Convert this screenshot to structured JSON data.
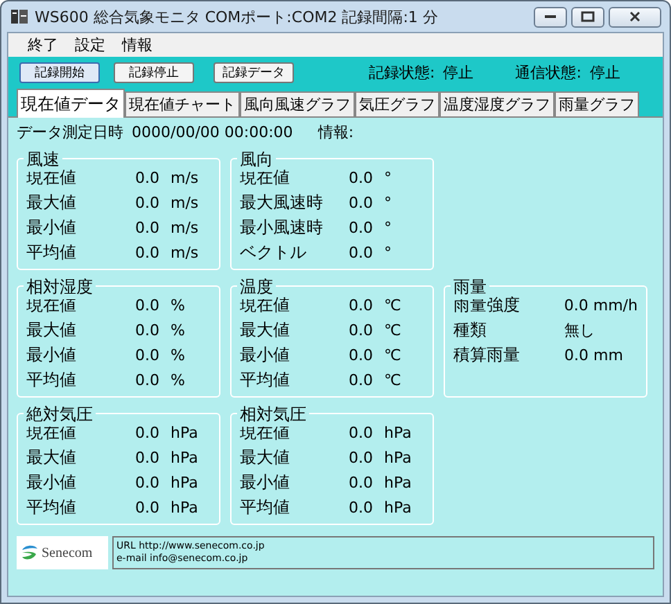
{
  "window": {
    "title": "WS600 総合気象モニタ COMポート:COM2 記録間隔:1 分"
  },
  "menu": [
    "終了",
    "設定",
    "情報"
  ],
  "toolbar": {
    "buttons": [
      {
        "label": "記録開始",
        "focused": true
      },
      {
        "label": "記録停止",
        "focused": false
      },
      {
        "label": "記録データ",
        "focused": false
      }
    ],
    "statuses": [
      {
        "label": "記録状態:",
        "value": "停止"
      },
      {
        "label": "通信状態:",
        "value": "停止"
      }
    ]
  },
  "tabs": [
    {
      "label": "現在値データ",
      "selected": true
    },
    {
      "label": "現在値チャート",
      "selected": false
    },
    {
      "label": "風向風速グラフ",
      "selected": false
    },
    {
      "label": "気圧グラフ",
      "selected": false
    },
    {
      "label": "温度湿度グラフ",
      "selected": false
    },
    {
      "label": "雨量グラフ",
      "selected": false
    }
  ],
  "info_line": {
    "timestamp_label": "データ測定日時",
    "timestamp": "0000/00/00 00:00:00",
    "info_label": "情報:"
  },
  "panel_rows": [
    {
      "groups": [
        {
          "title": "風速",
          "rows": [
            {
              "label": "現在値",
              "value": "0.0",
              "unit": "m/s"
            },
            {
              "label": "最大値",
              "value": "0.0",
              "unit": "m/s"
            },
            {
              "label": "最小値",
              "value": "0.0",
              "unit": "m/s"
            },
            {
              "label": "平均値",
              "value": "0.0",
              "unit": "m/s"
            }
          ]
        },
        {
          "title": "風向",
          "rows": [
            {
              "label": "現在値",
              "value": "0.0",
              "unit": "°"
            },
            {
              "label": "最大風速時",
              "value": "0.0",
              "unit": "°"
            },
            {
              "label": "最小風速時",
              "value": "0.0",
              "unit": "°"
            },
            {
              "label": "ベクトル",
              "value": "0.0",
              "unit": "°"
            }
          ]
        }
      ]
    },
    {
      "groups": [
        {
          "title": "相対湿度",
          "rows": [
            {
              "label": "現在値",
              "value": "0.0",
              "unit": "%"
            },
            {
              "label": "最大値",
              "value": "0.0",
              "unit": "%"
            },
            {
              "label": "最小値",
              "value": "0.0",
              "unit": "%"
            },
            {
              "label": "平均値",
              "value": "0.0",
              "unit": "%"
            }
          ]
        },
        {
          "title": "温度",
          "rows": [
            {
              "label": "現在値",
              "value": "0.0",
              "unit": "℃"
            },
            {
              "label": "最大値",
              "value": "0.0",
              "unit": "℃"
            },
            {
              "label": "最小値",
              "value": "0.0",
              "unit": "℃"
            },
            {
              "label": "平均値",
              "value": "0.0",
              "unit": "℃"
            }
          ]
        },
        {
          "title": "雨量",
          "rows": [
            {
              "label": "雨量強度",
              "value": "0.0 mm/h"
            },
            {
              "label": "種類",
              "value": "無し"
            },
            {
              "label": "積算雨量",
              "value": "0.0 mm"
            }
          ]
        }
      ]
    },
    {
      "groups": [
        {
          "title": "絶対気圧",
          "rows": [
            {
              "label": "現在値",
              "value": "0.0",
              "unit": "hPa"
            },
            {
              "label": "最大値",
              "value": "0.0",
              "unit": "hPa"
            },
            {
              "label": "最小値",
              "value": "0.0",
              "unit": "hPa"
            },
            {
              "label": "平均値",
              "value": "0.0",
              "unit": "hPa"
            }
          ]
        },
        {
          "title": "相対気圧",
          "rows": [
            {
              "label": "現在値",
              "value": "0.0",
              "unit": "hPa"
            },
            {
              "label": "最大値",
              "value": "0.0",
              "unit": "hPa"
            },
            {
              "label": "最小値",
              "value": "0.0",
              "unit": "hPa"
            },
            {
              "label": "平均値",
              "value": "0.0",
              "unit": "hPa"
            }
          ]
        }
      ]
    }
  ],
  "footer": {
    "logo_text": "Senecom",
    "contact": [
      "URL http://www.senecom.co.jp",
      "e-mail info@senecom.co.jp"
    ]
  }
}
